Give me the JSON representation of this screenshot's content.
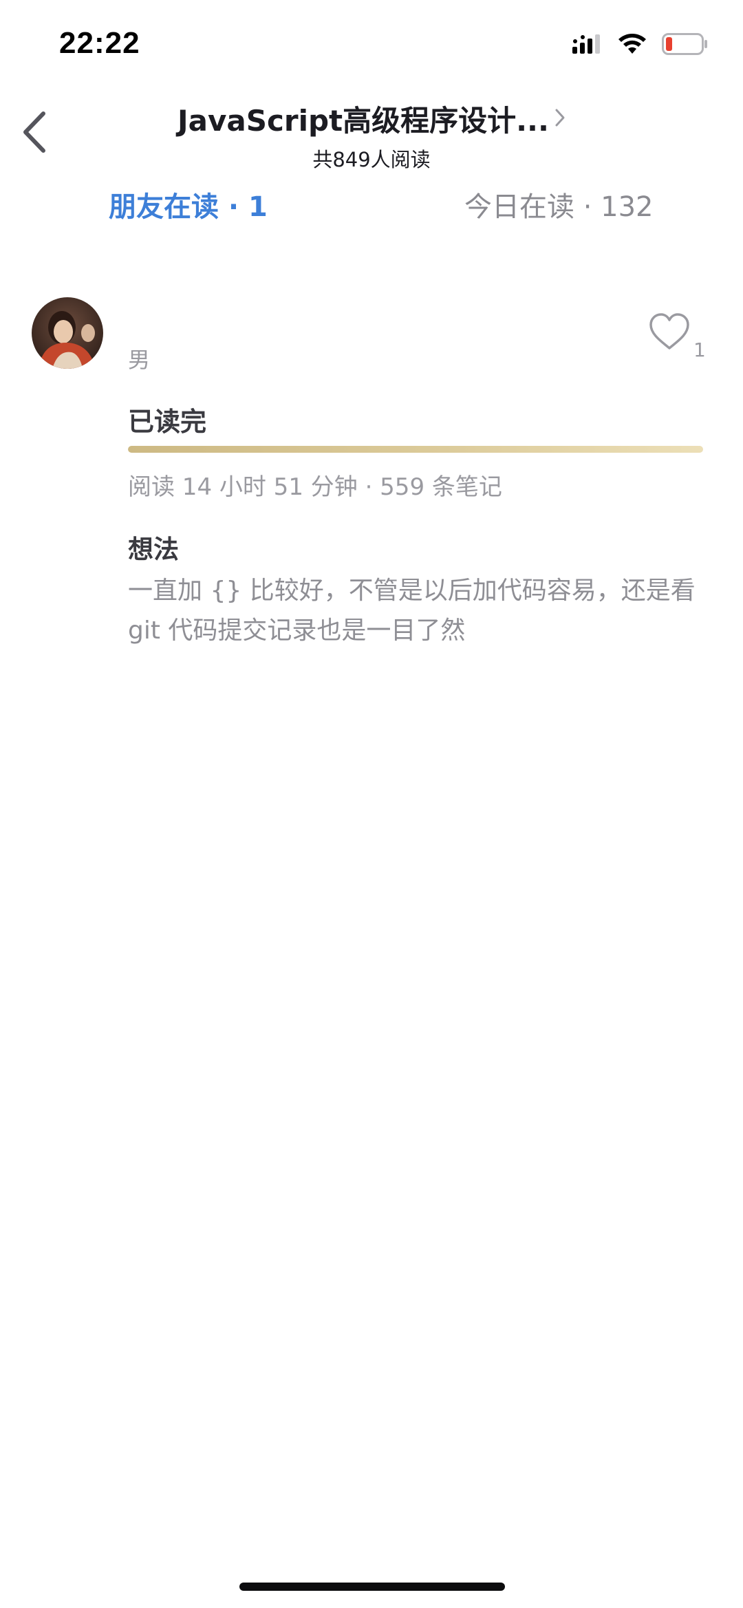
{
  "status_bar": {
    "time": "22:22",
    "icons": [
      "cellular-signal-icon",
      "wifi-icon",
      "battery-low-icon"
    ],
    "battery_color": "#e8402f"
  },
  "header": {
    "back_icon": "chevron-left-icon",
    "book_title": "JavaScript高级程序设计...",
    "title_chevron_icon": "chevron-right-icon",
    "reader_count": "共849人阅读"
  },
  "tabs": [
    {
      "label": "朋友在读 · 1",
      "active": true
    },
    {
      "label": "今日在读 · 132",
      "active": false
    }
  ],
  "colors": {
    "active_tab": "#3d7fd8",
    "inactive_tab": "#8a8a90",
    "progress_gold": "#cdb983"
  },
  "entry": {
    "avatar_icon": "user-avatar",
    "gender": "男",
    "like_icon": "heart-outline-icon",
    "like_count": "1",
    "status": "已读完",
    "progress_fraction": 1.0,
    "reading_stats": "阅读 14 小时 51 分钟 · 559 条笔记",
    "thought_heading": "想法",
    "thought_text": "一直加 {} 比较好，不管是以后加代码容易，还是看 git 代码提交记录也是一目了然"
  }
}
